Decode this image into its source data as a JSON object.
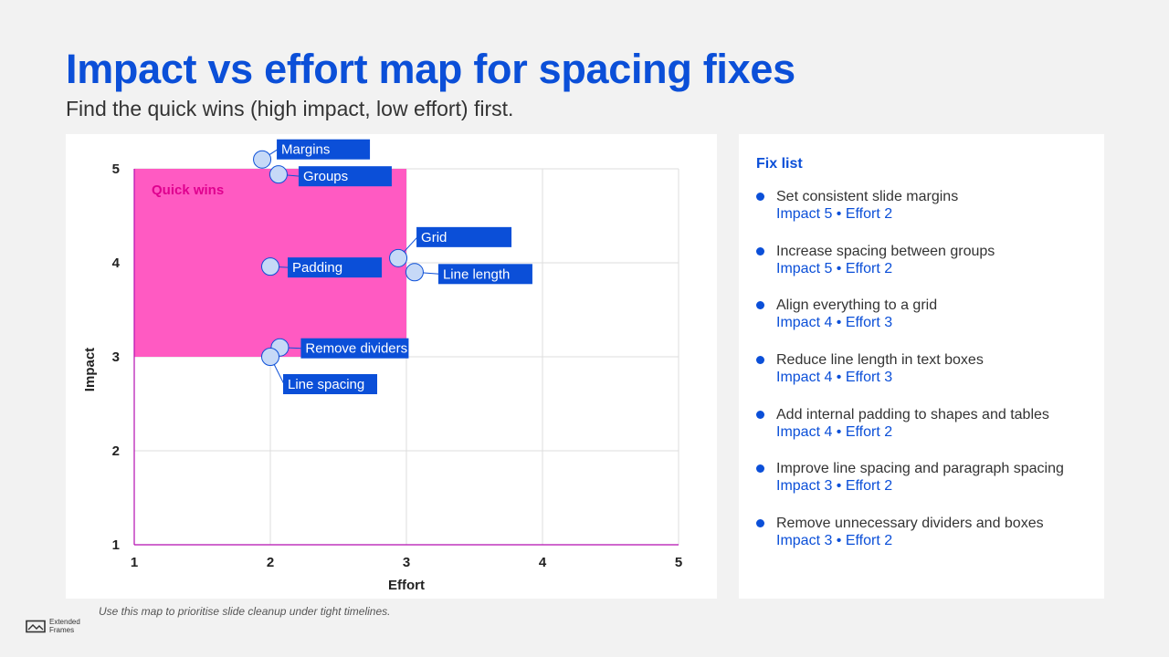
{
  "title": "Impact vs effort map for spacing fixes",
  "subtitle": "Find the quick wins (high impact, low effort) first.",
  "chart_data": {
    "type": "scatter",
    "xlabel": "Effort",
    "ylabel": "Impact",
    "xlim": [
      1,
      5
    ],
    "ylim": [
      1,
      5
    ],
    "xticks": [
      "1",
      "2",
      "3",
      "4",
      "5"
    ],
    "yticks": [
      "1",
      "2",
      "3",
      "4",
      "5"
    ],
    "grid": true,
    "region": {
      "label": "Quick wins",
      "x": [
        1,
        3
      ],
      "y": [
        3,
        5
      ],
      "color": "#ff5ac2"
    },
    "points": [
      {
        "label": "Margins",
        "x": 1.94,
        "y": 5.1
      },
      {
        "label": "Groups",
        "x": 2.06,
        "y": 4.94
      },
      {
        "label": "Grid",
        "x": 2.94,
        "y": 4.05
      },
      {
        "label": "Line length",
        "x": 3.06,
        "y": 3.9
      },
      {
        "label": "Padding",
        "x": 2.0,
        "y": 3.96
      },
      {
        "label": "Remove dividers",
        "x": 2.07,
        "y": 3.1
      },
      {
        "label": "Line spacing",
        "x": 2.0,
        "y": 3.0
      }
    ]
  },
  "fix_list": {
    "heading": "Fix list",
    "items": [
      {
        "text": "Set consistent slide margins",
        "meta": "Impact 5 • Effort 2"
      },
      {
        "text": "Increase spacing between groups",
        "meta": "Impact 5 • Effort 2"
      },
      {
        "text": "Align everything to a grid",
        "meta": "Impact 4 • Effort 3"
      },
      {
        "text": "Reduce line length in text boxes",
        "meta": "Impact 4 • Effort 3"
      },
      {
        "text": "Add internal padding to shapes and tables",
        "meta": "Impact 4 • Effort 2"
      },
      {
        "text": "Improve line spacing and paragraph spacing",
        "meta": "Impact 3 • Effort 2"
      },
      {
        "text": "Remove unnecessary dividers and boxes",
        "meta": "Impact 3 • Effort 2"
      }
    ]
  },
  "footnote": "Use this map to prioritise slide cleanup under tight timelines.",
  "logo": {
    "line1": "Extended",
    "line2": "Frames"
  },
  "colors": {
    "accent": "#0b4fd8",
    "quick_wins": "#ff5ac2",
    "point_fill": "#c6d9f7",
    "grid": "#dddddd"
  }
}
